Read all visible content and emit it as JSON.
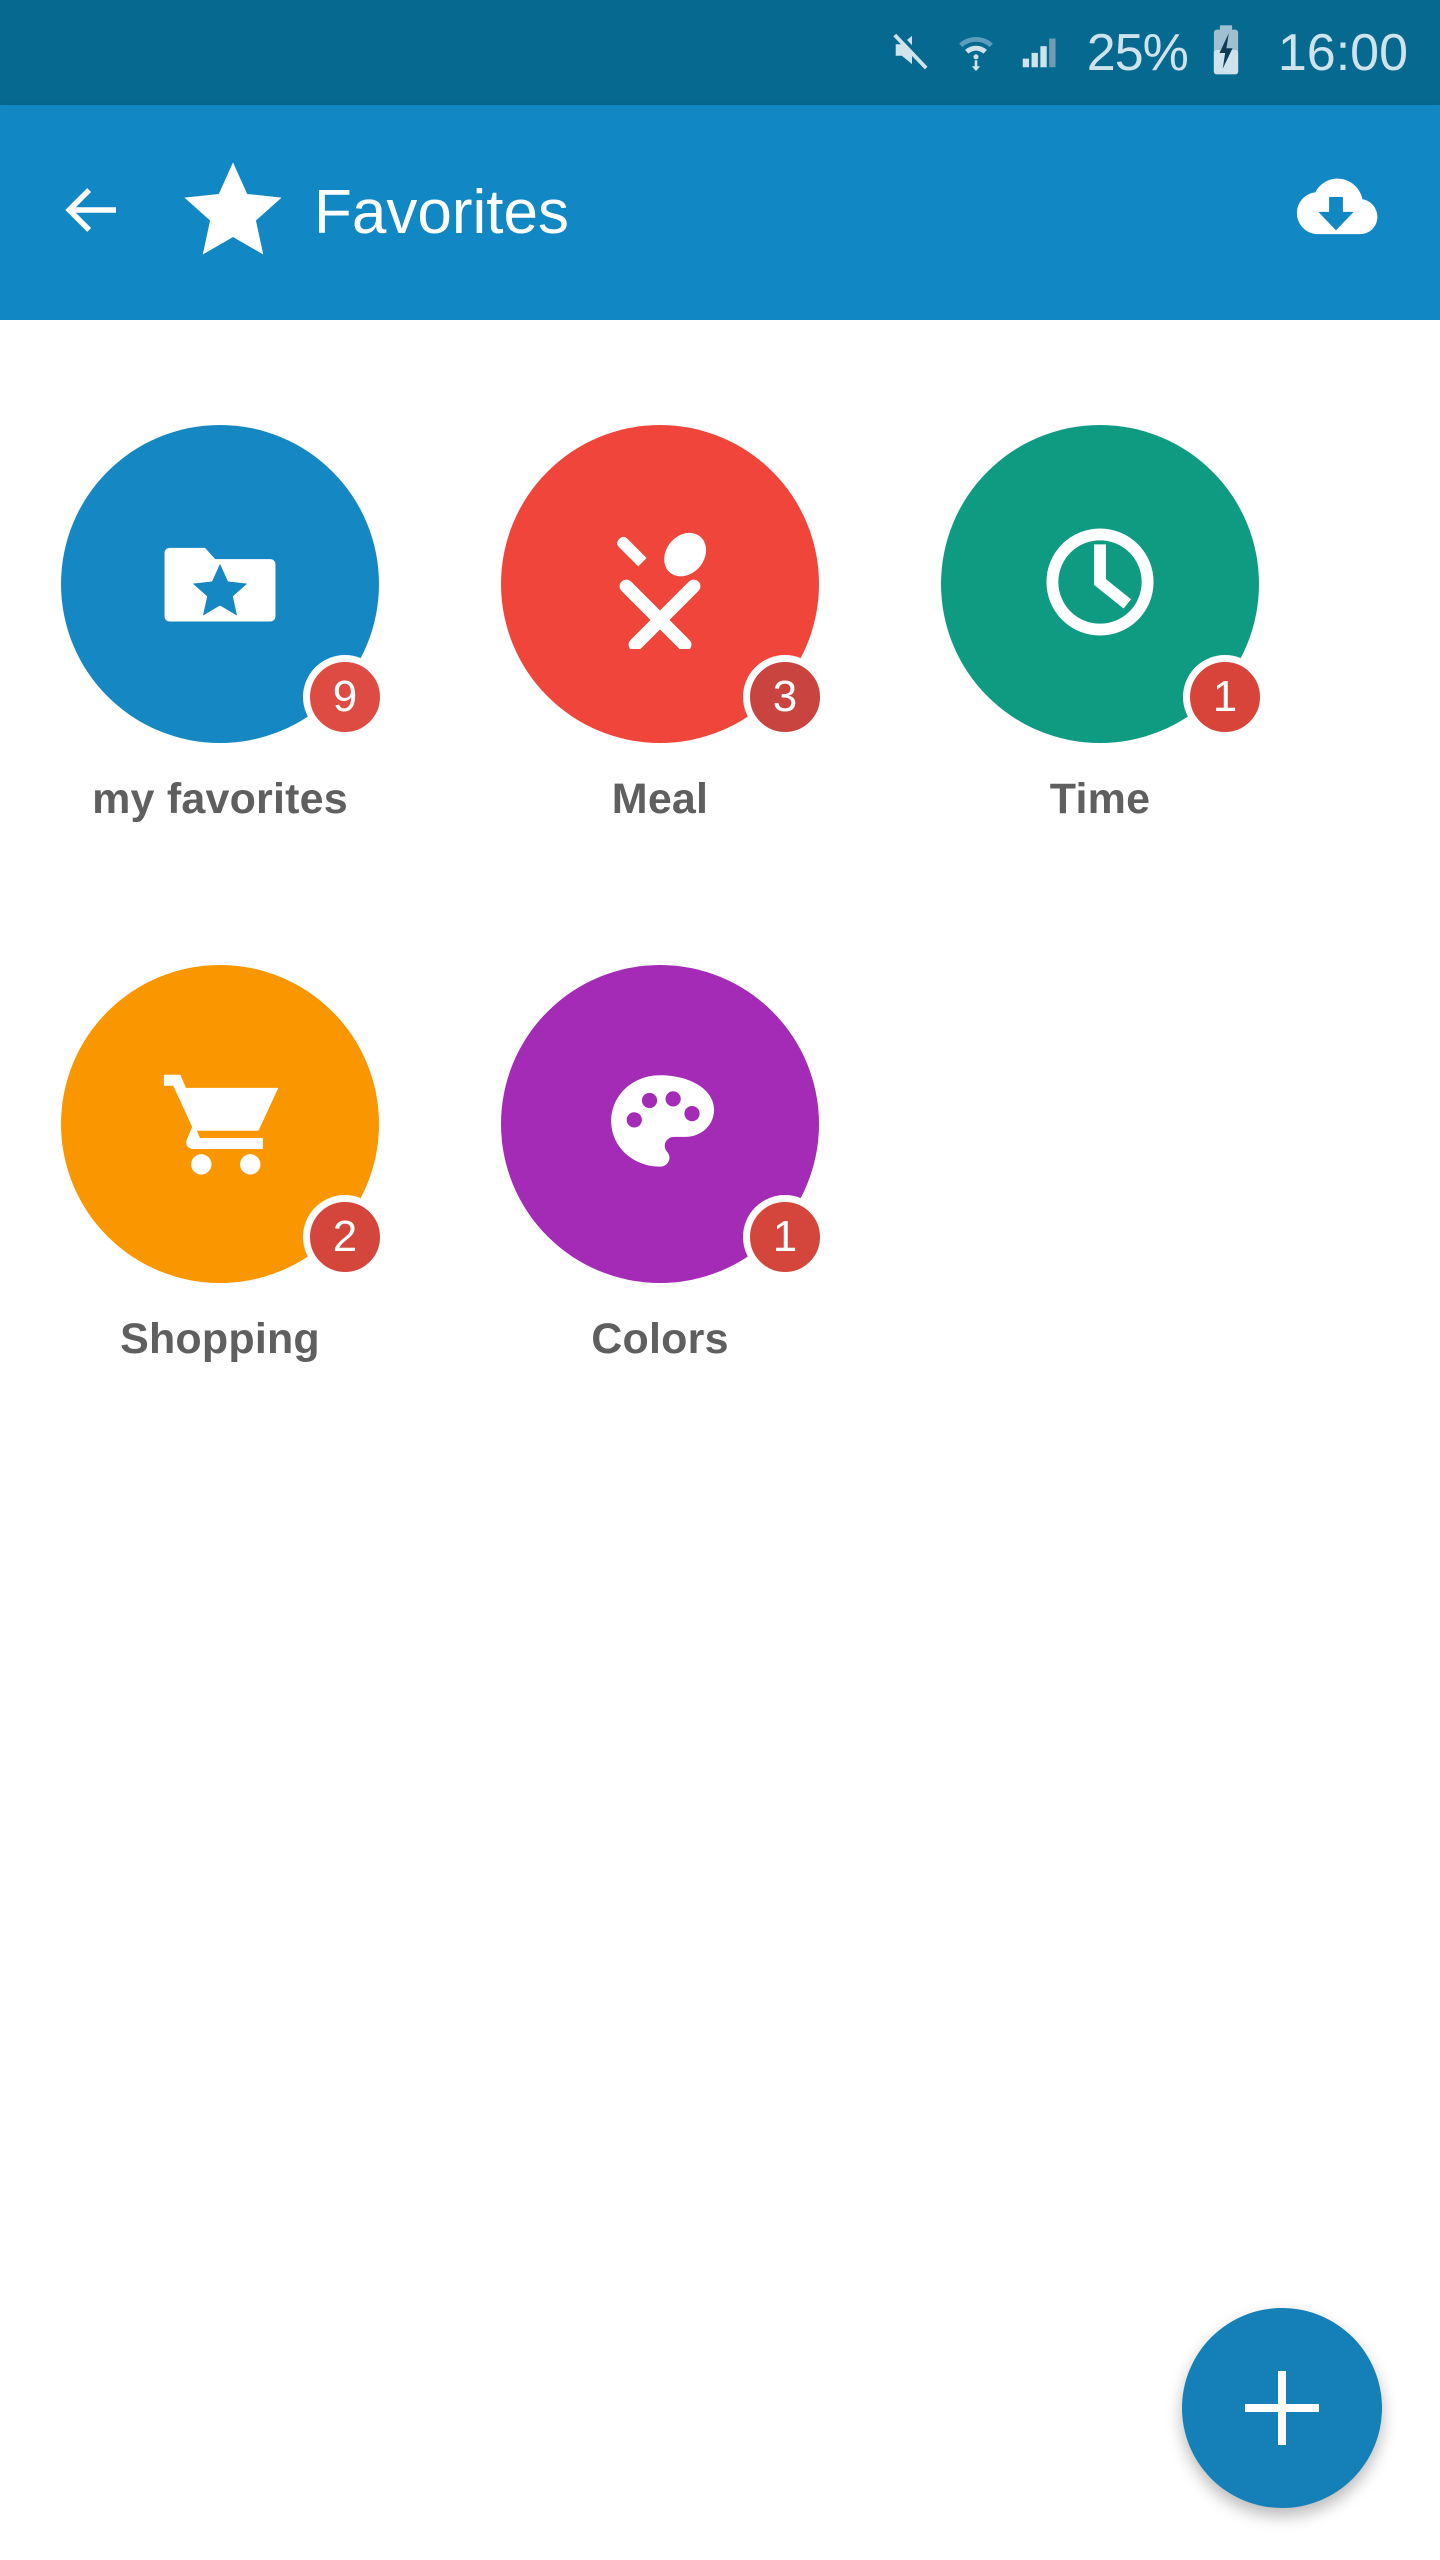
{
  "status_bar": {
    "background": "#06698f",
    "text_color": "#cfe3ec",
    "battery_percent": "25%",
    "time": "16:00",
    "icons": [
      "mute-icon",
      "wifi-icon",
      "signal-icon",
      "battery-charging-icon"
    ]
  },
  "app_bar": {
    "background": "#1187c4",
    "back_icon": "back-arrow-icon",
    "brand_icon": "star-icon",
    "title": "Favorites",
    "action_icon": "cloud-download-icon"
  },
  "grid": {
    "items": [
      {
        "label": "my favorites",
        "badge": "9",
        "color": "#1587c2",
        "badge_color": "#dd4b43",
        "icon": "folder-star-icon"
      },
      {
        "label": "Meal",
        "badge": "3",
        "color": "#f0453a",
        "badge_color": "#c9443f",
        "icon": "cutlery-icon"
      },
      {
        "label": "Time",
        "badge": "1",
        "color": "#0f9b82",
        "badge_color": "#d84439",
        "icon": "clock-icon"
      },
      {
        "label": "Shopping",
        "badge": "2",
        "color": "#fa9600",
        "badge_color": "#d4453c",
        "icon": "shopping-cart-icon"
      },
      {
        "label": "Colors",
        "badge": "1",
        "color": "#a32bb5",
        "badge_color": "#d4453c",
        "icon": "palette-icon"
      }
    ]
  },
  "fab": {
    "label": "+",
    "color": "#1580b8",
    "icon": "plus-icon"
  }
}
